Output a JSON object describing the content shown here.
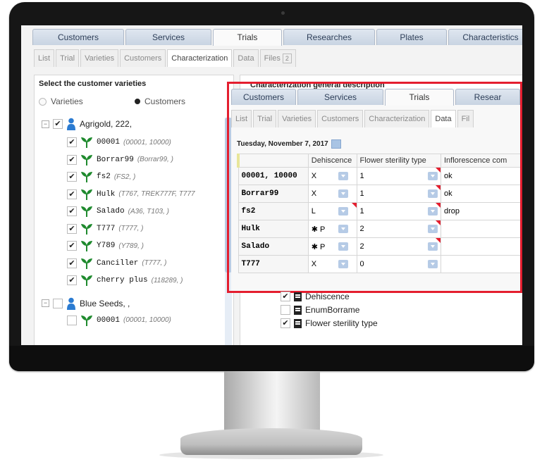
{
  "top_tabs": [
    {
      "label": "Customers",
      "active": false
    },
    {
      "label": "Services",
      "active": false
    },
    {
      "label": "Trials",
      "active": true
    },
    {
      "label": "Researches",
      "active": false
    },
    {
      "label": "Plates",
      "active": false
    },
    {
      "label": "Characteristics",
      "active": false
    }
  ],
  "sub_tabs": [
    {
      "label": "List",
      "active": false
    },
    {
      "label": "Trial",
      "active": false
    },
    {
      "label": "Varieties",
      "active": false
    },
    {
      "label": "Customers",
      "active": false
    },
    {
      "label": "Characterization",
      "active": true
    },
    {
      "label": "Data",
      "active": false
    },
    {
      "label": "Files",
      "badge": "2",
      "active": false
    }
  ],
  "left_panel": {
    "title": "Select the customer varieties",
    "radio_varieties": "Varieties",
    "radio_customers": "Customers",
    "groups": [
      {
        "name": "Agrigold, 222,",
        "expanded": true,
        "checked": true,
        "items": [
          {
            "name": "00001",
            "detail": "(00001, 10000)",
            "checked": true
          },
          {
            "name": "Borrar99",
            "detail": "(Borrar99, )",
            "checked": true
          },
          {
            "name": "fs2",
            "detail": "(FS2, )",
            "checked": true
          },
          {
            "name": "Hulk",
            "detail": "(T767, TREK777F, T777",
            "checked": true
          },
          {
            "name": "Salado",
            "detail": "(A36, T103, )",
            "checked": true
          },
          {
            "name": "T777",
            "detail": "(T777, )",
            "checked": true
          },
          {
            "name": "Y789",
            "detail": "(Y789, )",
            "checked": true
          },
          {
            "name": "Canciller",
            "detail": "(T777, )",
            "checked": true
          },
          {
            "name": "cherry plus",
            "detail": "(118289, )",
            "checked": true
          }
        ]
      },
      {
        "name": "Blue Seeds, ,",
        "expanded": true,
        "checked": false,
        "items": [
          {
            "name": "00001",
            "detail": "(00001, 10000)",
            "checked": false
          }
        ]
      }
    ]
  },
  "right_panel": {
    "title": "Characterization general description",
    "inner_top_tabs": [
      {
        "label": "Customers",
        "active": false
      },
      {
        "label": "Services",
        "active": false
      },
      {
        "label": "Trials",
        "active": true
      },
      {
        "label": "Resear",
        "active": false
      }
    ],
    "inner_sub_tabs": [
      {
        "label": "List",
        "active": false
      },
      {
        "label": "Trial",
        "active": false
      },
      {
        "label": "Varieties",
        "active": false
      },
      {
        "label": "Customers",
        "active": false
      },
      {
        "label": "Characterization",
        "active": false
      },
      {
        "label": "Data",
        "active": true
      },
      {
        "label": "Fil",
        "active": false
      }
    ],
    "date": "Tuesday, November 7, 2017",
    "columns": [
      "Dehiscence",
      "Flower sterility type",
      "Inflorescence com"
    ],
    "rows": [
      {
        "name": "00001, 10000",
        "dehiscence": "X",
        "sterility": "1",
        "inflorescence": "ok",
        "flag_deh": false,
        "flag_ster": true
      },
      {
        "name": "Borrar99",
        "dehiscence": "X",
        "sterility": "1",
        "inflorescence": "ok",
        "flag_deh": false,
        "flag_ster": true
      },
      {
        "name": "fs2",
        "dehiscence": "L",
        "sterility": "1",
        "inflorescence": "drop",
        "flag_deh": true,
        "flag_ster": true
      },
      {
        "name": "Hulk",
        "dehiscence": "✱ P",
        "sterility": "2",
        "inflorescence": "",
        "flag_deh": false,
        "flag_ster": true
      },
      {
        "name": "Salado",
        "dehiscence": "✱ P",
        "sterility": "2",
        "inflorescence": "",
        "flag_deh": false,
        "flag_ster": true
      },
      {
        "name": "T777",
        "dehiscence": "X",
        "sterility": "0",
        "inflorescence": "",
        "flag_deh": false,
        "flag_ster": false
      }
    ],
    "characteristics": [
      {
        "label": "Dehiscence",
        "checked": true
      },
      {
        "label": "EnumBorrame",
        "checked": false
      },
      {
        "label": "Flower sterility type",
        "checked": true
      }
    ]
  },
  "colors": {
    "highlight": "#e41e2f",
    "tab_blue": "#c9d4e2",
    "plant_green": "#1f8a2e",
    "person_blue": "#2b7bd1"
  }
}
